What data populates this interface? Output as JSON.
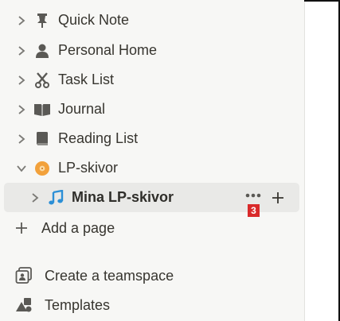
{
  "sidebar": {
    "items": [
      {
        "label": "Quick Note",
        "icon": "pin-icon"
      },
      {
        "label": "Personal Home",
        "icon": "person-icon"
      },
      {
        "label": "Task List",
        "icon": "scissors-icon"
      },
      {
        "label": "Journal",
        "icon": "book-open-icon"
      },
      {
        "label": "Reading List",
        "icon": "book-icon"
      },
      {
        "label": "LP-skivor",
        "icon": "vinyl-icon"
      }
    ],
    "selected_item": {
      "label": "Mina LP-skivor",
      "icon": "music-note-icon"
    },
    "badge": "3",
    "add_page_label": "Add a page",
    "bottom": [
      {
        "label": "Create a teamspace",
        "icon": "teamspace-icon"
      },
      {
        "label": "Templates",
        "icon": "templates-icon"
      }
    ]
  },
  "colors": {
    "sidebar_bg": "#f7f7f5",
    "selected_bg": "#e9e9e7",
    "text": "#37352f",
    "icon_gray": "#5a5955",
    "badge": "#d92a2a",
    "music_note": "#2b8fd6",
    "vinyl": "#f2a13b"
  }
}
